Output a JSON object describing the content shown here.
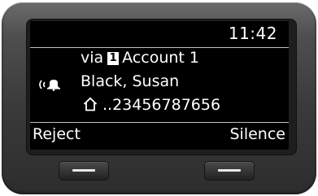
{
  "status_bar": {
    "time": "11:42"
  },
  "call": {
    "via_prefix": "via",
    "account_badge": "1",
    "account_name": "Account 1",
    "caller_name": "Black, Susan",
    "number": "..23456787656",
    "ring_icon": "ringing-bell-icon",
    "number_type_icon": "home-icon"
  },
  "softkeys": {
    "left": "Reject",
    "right": "Silence"
  },
  "colors": {
    "screen_bg": "#000000",
    "text": "#ffffff",
    "housing": "#3a3a3a"
  }
}
